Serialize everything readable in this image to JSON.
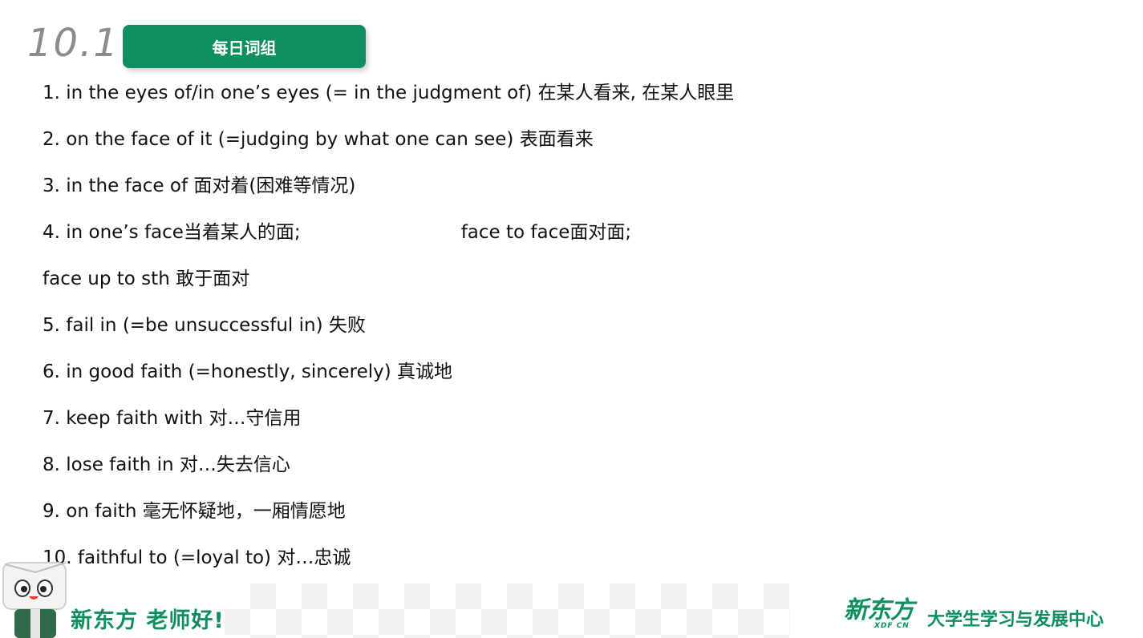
{
  "header": {
    "date": "10.1",
    "title": "每日词组"
  },
  "phrases": [
    "1. in the eyes of/in one’s eyes (= in the judgment of) 在某人看来, 在某人眼里",
    "2. on the face of it (=judging by what one can see) 表面看来",
    "3. in the face of 面对着(困难等情况)",
    "4. in one’s face当着某人的面;",
    "face up to sth 敢于面对",
    "5. fail in (=be unsuccessful in) 失败",
    "6. in good faith (=honestly, sincerely) 真诚地",
    "7. keep faith with 对…守信用",
    "8. lose faith in 对…失去信心",
    "9. on faith 毫无怀疑地，一厢情愿地",
    "10. faithful to (=loyal to) 对…忠诚"
  ],
  "phrase_4_extra": "face to face面对面;",
  "footer": {
    "slogan": "新东方 老师好!",
    "logo_main": "新东方",
    "logo_sub": "XDF CN",
    "center_name": "大学生学习与发展中心"
  },
  "colors": {
    "brand_green": "#0d8f5e",
    "date_gray": "#8c8c8c"
  }
}
